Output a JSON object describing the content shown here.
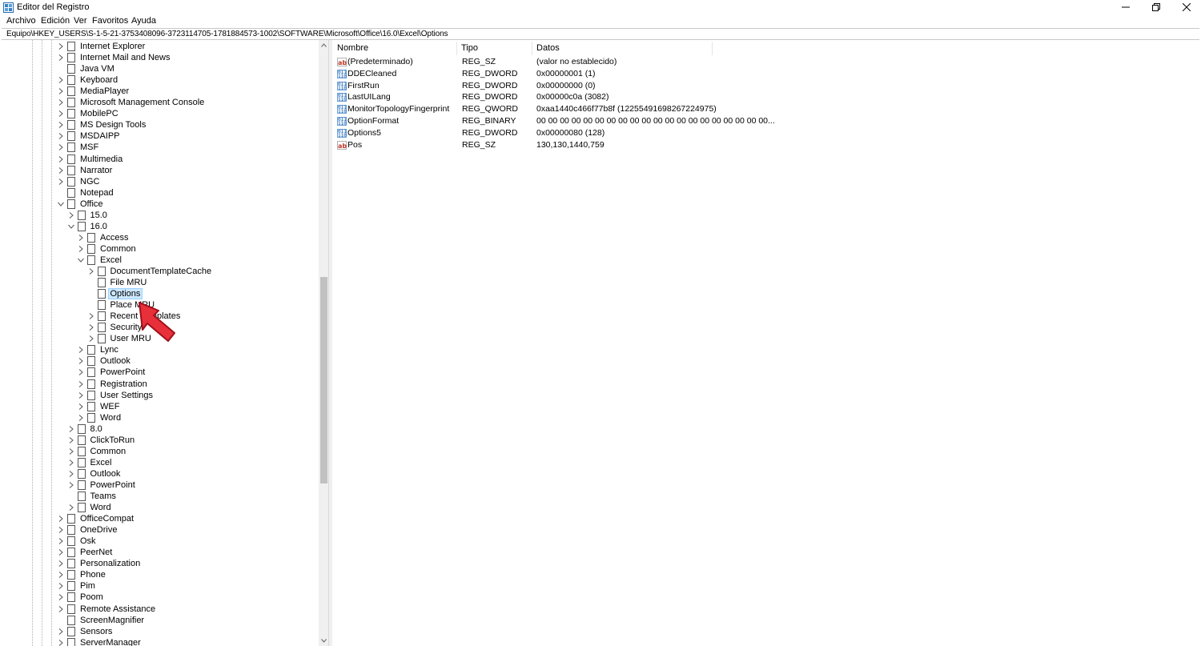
{
  "window": {
    "title": "Editor del Registro"
  },
  "menu": [
    "Archivo",
    "Edición",
    "Ver",
    "Favoritos",
    "Ayuda"
  ],
  "address": "Equipo\\HKEY_USERS\\S-1-5-21-3753408096-3723114705-1781884573-1002\\SOFTWARE\\Microsoft\\Office\\16.0\\Excel\\Options",
  "tree": [
    {
      "label": "Internet Explorer",
      "level": 0,
      "state": "collapsed"
    },
    {
      "label": "Internet Mail and News",
      "level": 0,
      "state": "collapsed"
    },
    {
      "label": "Java VM",
      "level": 0,
      "state": "leaf"
    },
    {
      "label": "Keyboard",
      "level": 0,
      "state": "collapsed"
    },
    {
      "label": "MediaPlayer",
      "level": 0,
      "state": "collapsed"
    },
    {
      "label": "Microsoft Management Console",
      "level": 0,
      "state": "collapsed"
    },
    {
      "label": "MobilePC",
      "level": 0,
      "state": "collapsed"
    },
    {
      "label": "MS Design Tools",
      "level": 0,
      "state": "collapsed"
    },
    {
      "label": "MSDAIPP",
      "level": 0,
      "state": "collapsed"
    },
    {
      "label": "MSF",
      "level": 0,
      "state": "collapsed"
    },
    {
      "label": "Multimedia",
      "level": 0,
      "state": "collapsed"
    },
    {
      "label": "Narrator",
      "level": 0,
      "state": "collapsed"
    },
    {
      "label": "NGC",
      "level": 0,
      "state": "collapsed"
    },
    {
      "label": "Notepad",
      "level": 0,
      "state": "leaf"
    },
    {
      "label": "Office",
      "level": 0,
      "state": "expanded"
    },
    {
      "label": "15.0",
      "level": 1,
      "state": "collapsed"
    },
    {
      "label": "16.0",
      "level": 1,
      "state": "expanded"
    },
    {
      "label": "Access",
      "level": 2,
      "state": "collapsed"
    },
    {
      "label": "Common",
      "level": 2,
      "state": "collapsed"
    },
    {
      "label": "Excel",
      "level": 2,
      "state": "expanded"
    },
    {
      "label": "DocumentTemplateCache",
      "level": 3,
      "state": "collapsed"
    },
    {
      "label": "File MRU",
      "level": 3,
      "state": "leaf"
    },
    {
      "label": "Options",
      "level": 3,
      "state": "leaf",
      "selected": true
    },
    {
      "label": "Place MRU",
      "level": 3,
      "state": "leaf"
    },
    {
      "label": "Recent Templates",
      "level": 3,
      "state": "collapsed"
    },
    {
      "label": "Security",
      "level": 3,
      "state": "collapsed"
    },
    {
      "label": "User MRU",
      "level": 3,
      "state": "collapsed"
    },
    {
      "label": "Lync",
      "level": 2,
      "state": "collapsed"
    },
    {
      "label": "Outlook",
      "level": 2,
      "state": "collapsed"
    },
    {
      "label": "PowerPoint",
      "level": 2,
      "state": "collapsed"
    },
    {
      "label": "Registration",
      "level": 2,
      "state": "collapsed"
    },
    {
      "label": "User Settings",
      "level": 2,
      "state": "collapsed"
    },
    {
      "label": "WEF",
      "level": 2,
      "state": "collapsed"
    },
    {
      "label": "Word",
      "level": 2,
      "state": "collapsed"
    },
    {
      "label": "8.0",
      "level": 1,
      "state": "collapsed"
    },
    {
      "label": "ClickToRun",
      "level": 1,
      "state": "collapsed"
    },
    {
      "label": "Common",
      "level": 1,
      "state": "collapsed"
    },
    {
      "label": "Excel",
      "level": 1,
      "state": "collapsed"
    },
    {
      "label": "Outlook",
      "level": 1,
      "state": "collapsed"
    },
    {
      "label": "PowerPoint",
      "level": 1,
      "state": "collapsed"
    },
    {
      "label": "Teams",
      "level": 1,
      "state": "leaf"
    },
    {
      "label": "Word",
      "level": 1,
      "state": "collapsed"
    },
    {
      "label": "OfficeCompat",
      "level": 0,
      "state": "collapsed"
    },
    {
      "label": "OneDrive",
      "level": 0,
      "state": "collapsed"
    },
    {
      "label": "Osk",
      "level": 0,
      "state": "collapsed"
    },
    {
      "label": "PeerNet",
      "level": 0,
      "state": "collapsed"
    },
    {
      "label": "Personalization",
      "level": 0,
      "state": "collapsed"
    },
    {
      "label": "Phone",
      "level": 0,
      "state": "collapsed"
    },
    {
      "label": "Pim",
      "level": 0,
      "state": "collapsed"
    },
    {
      "label": "Poom",
      "level": 0,
      "state": "collapsed"
    },
    {
      "label": "Remote Assistance",
      "level": 0,
      "state": "collapsed"
    },
    {
      "label": "ScreenMagnifier",
      "level": 0,
      "state": "leaf"
    },
    {
      "label": "Sensors",
      "level": 0,
      "state": "collapsed"
    },
    {
      "label": "ServerManager",
      "level": 0,
      "state": "collapsed"
    }
  ],
  "list": {
    "columns": [
      "Nombre",
      "Tipo",
      "Datos"
    ],
    "rows": [
      {
        "icon": "string-value-icon",
        "name": "(Predeterminado)",
        "type": "REG_SZ",
        "data": "(valor no establecido)"
      },
      {
        "icon": "binary-value-icon",
        "name": "DDECleaned",
        "type": "REG_DWORD",
        "data": "0x00000001 (1)"
      },
      {
        "icon": "binary-value-icon",
        "name": "FirstRun",
        "type": "REG_DWORD",
        "data": "0x00000000 (0)"
      },
      {
        "icon": "binary-value-icon",
        "name": "LastUILang",
        "type": "REG_DWORD",
        "data": "0x00000c0a (3082)"
      },
      {
        "icon": "binary-value-icon",
        "name": "MonitorTopologyFingerprint",
        "type": "REG_QWORD",
        "data": "0xaa1440c466f77b8f (12255491698267224975)"
      },
      {
        "icon": "binary-value-icon",
        "name": "OptionFormat",
        "type": "REG_BINARY",
        "data": "00 00 00 00 00 00 00 00 00 00 00 00 00 00 00 00 00 00 00 00..."
      },
      {
        "icon": "binary-value-icon",
        "name": "Options5",
        "type": "REG_DWORD",
        "data": "0x00000080 (128)"
      },
      {
        "icon": "string-value-icon",
        "name": "Pos",
        "type": "REG_SZ",
        "data": "130,130,1440,759"
      }
    ]
  },
  "colors": {
    "selection": "#cce8ff",
    "cursor_fill": "#e8303a",
    "cursor_outline": "#a0101a"
  }
}
